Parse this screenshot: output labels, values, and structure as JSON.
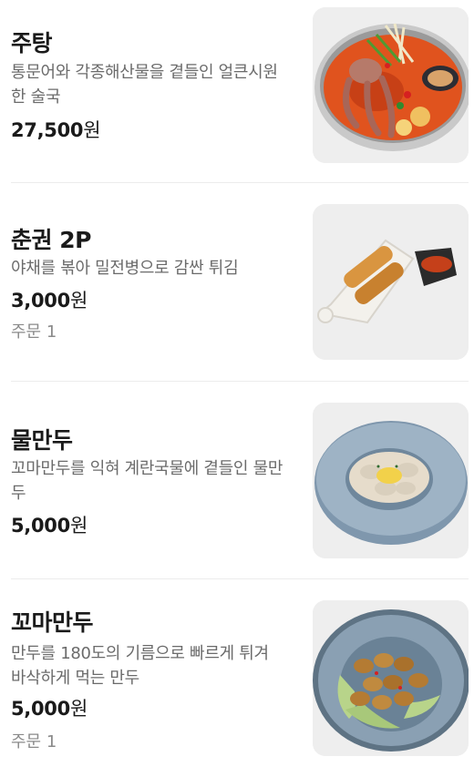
{
  "menu": {
    "items": [
      {
        "name": "주탕",
        "description": "통문어와 각종해산물을 곁들인 얼큰시원한 술국",
        "price_number": "27,500",
        "price_unit": "원",
        "order_text": "",
        "image_icon": "seafood-soup-photo"
      },
      {
        "name": "춘권 2P",
        "description": "야채를 볶아 밀전병으로 감싼 튀김",
        "price_number": "3,000",
        "price_unit": "원",
        "order_text": "주문 1",
        "image_icon": "spring-roll-photo"
      },
      {
        "name": "물만두",
        "description": "꼬마만두를 익혀 계란국물에 곁들인 물만두",
        "price_number": "5,000",
        "price_unit": "원",
        "order_text": "",
        "image_icon": "dumpling-soup-photo"
      },
      {
        "name": "꼬마만두",
        "description": "만두를 180도의 기름으로 빠르게 튀겨 바삭하게 먹는 만두",
        "price_number": "5,000",
        "price_unit": "원",
        "order_text": "주문 1",
        "image_icon": "fried-dumpling-photo"
      }
    ]
  },
  "colors": {
    "text_primary": "#1a1a1a",
    "text_secondary": "#6b6b6b",
    "text_muted": "#8a8a8a",
    "thumb_bg": "#eeeeee",
    "divider": "#ececec"
  }
}
